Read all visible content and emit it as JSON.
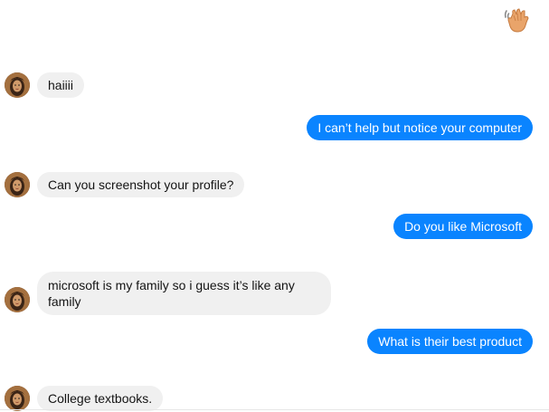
{
  "conversation": {
    "messages": [
      {
        "sender": "them",
        "text": "haiiii"
      },
      {
        "sender": "me",
        "text": "I can’t help but notice your computer"
      },
      {
        "sender": "them",
        "text": "Can you screenshot your profile?"
      },
      {
        "sender": "me",
        "text": "Do you like Microsoft"
      },
      {
        "sender": "them",
        "text": "microsoft is my family so i guess it’s like any family"
      },
      {
        "sender": "me",
        "text": "What is their best product"
      },
      {
        "sender": "them",
        "text": "College textbooks."
      }
    ]
  },
  "icons": {
    "wave": "waving-hand-icon",
    "avatar": "contact-avatar"
  },
  "colors": {
    "outgoing_bubble": "#0a84ff",
    "incoming_bubble": "#f0f0f0"
  }
}
